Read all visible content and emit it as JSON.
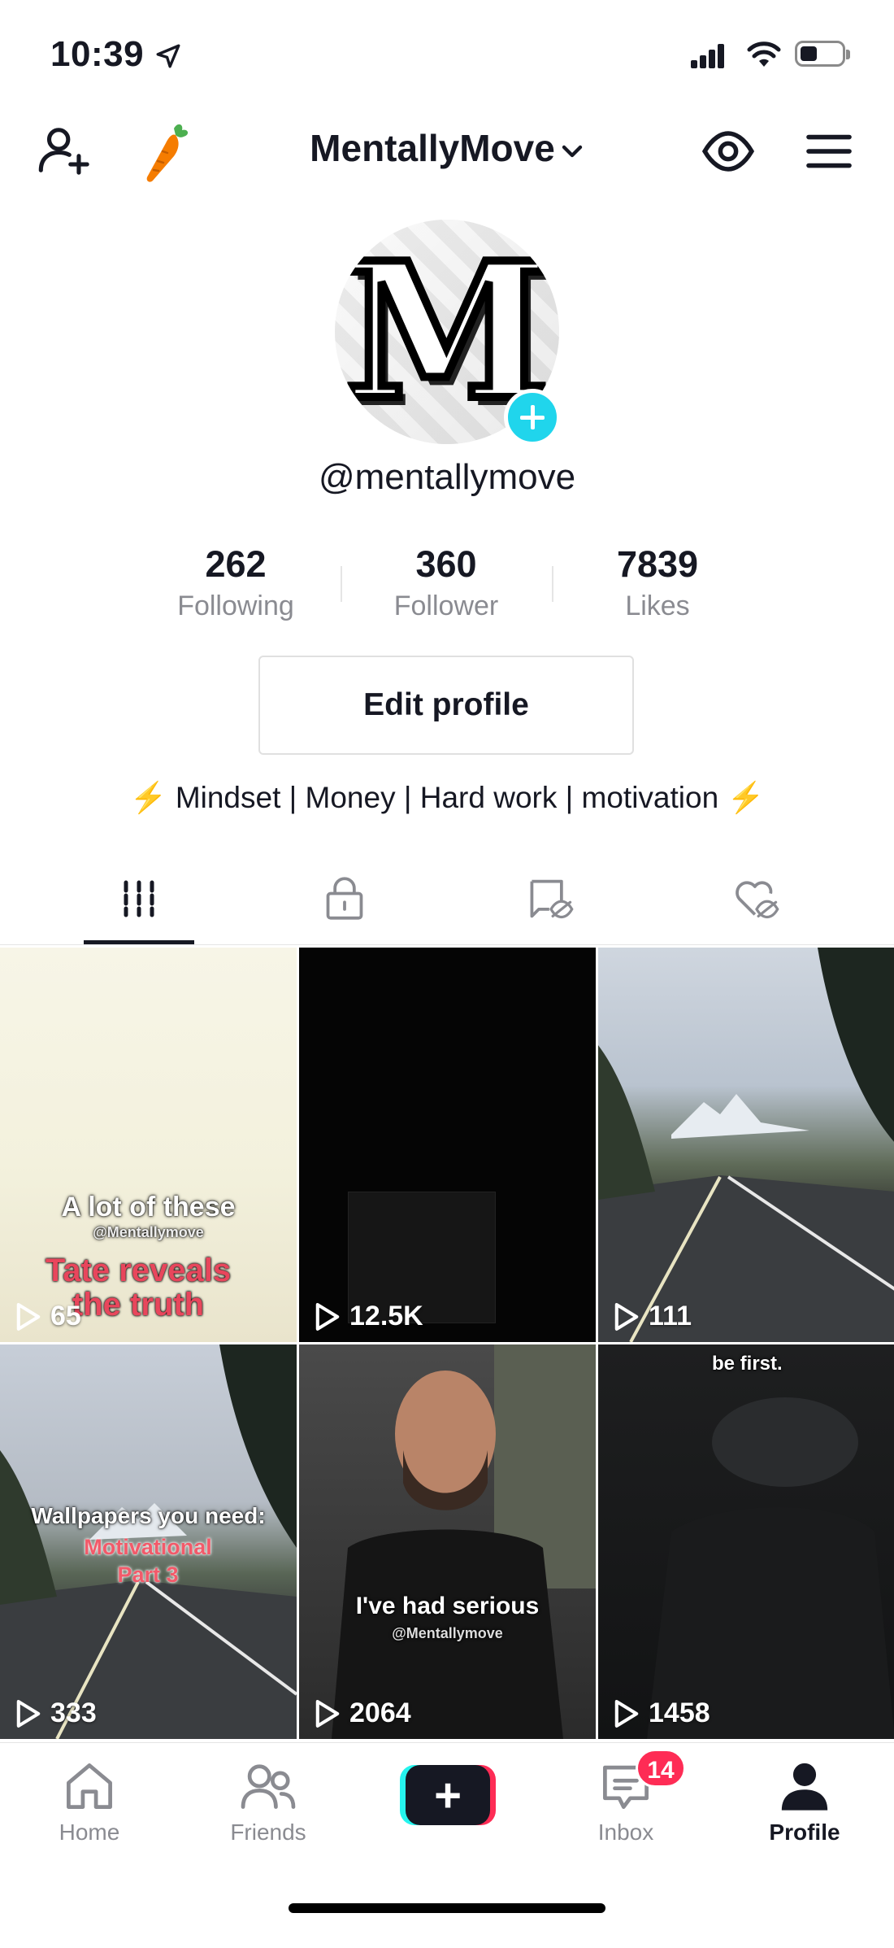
{
  "status_bar": {
    "time": "10:39"
  },
  "header": {
    "title": "MentallyMove"
  },
  "profile": {
    "avatar_letter": "M",
    "handle": "@mentallymove",
    "stats": [
      {
        "value": "262",
        "label": "Following"
      },
      {
        "value": "360",
        "label": "Follower"
      },
      {
        "value": "7839",
        "label": "Likes"
      }
    ],
    "edit_label": "Edit profile",
    "bio_text": "Mindset | Money | Hard work | motivation",
    "bio_emoji": "⚡"
  },
  "tabs": [
    "videos-grid-icon",
    "lock-icon",
    "tagged-hidden-icon",
    "liked-hidden-icon"
  ],
  "videos": [
    {
      "views": "65",
      "caption_white": "A lot of these",
      "caption_red": "Tate reveals the truth",
      "watermark": "@Mentallymove"
    },
    {
      "views": "12.5K"
    },
    {
      "views": "111"
    },
    {
      "views": "333",
      "caption_white": "Wallpapers you need:",
      "caption_red": "Motivational Part 3"
    },
    {
      "views": "2064",
      "caption_white": "I've had serious",
      "watermark": "@Mentallymove"
    },
    {
      "views": "1458",
      "caption_white": "be first."
    }
  ],
  "bottom_nav": {
    "home": "Home",
    "friends": "Friends",
    "inbox": "Inbox",
    "inbox_badge": "14",
    "profile": "Profile"
  },
  "colors": {
    "accent_red": "#fe2c55",
    "accent_cyan": "#25f4ee",
    "plus_blue": "#20d5ec"
  }
}
